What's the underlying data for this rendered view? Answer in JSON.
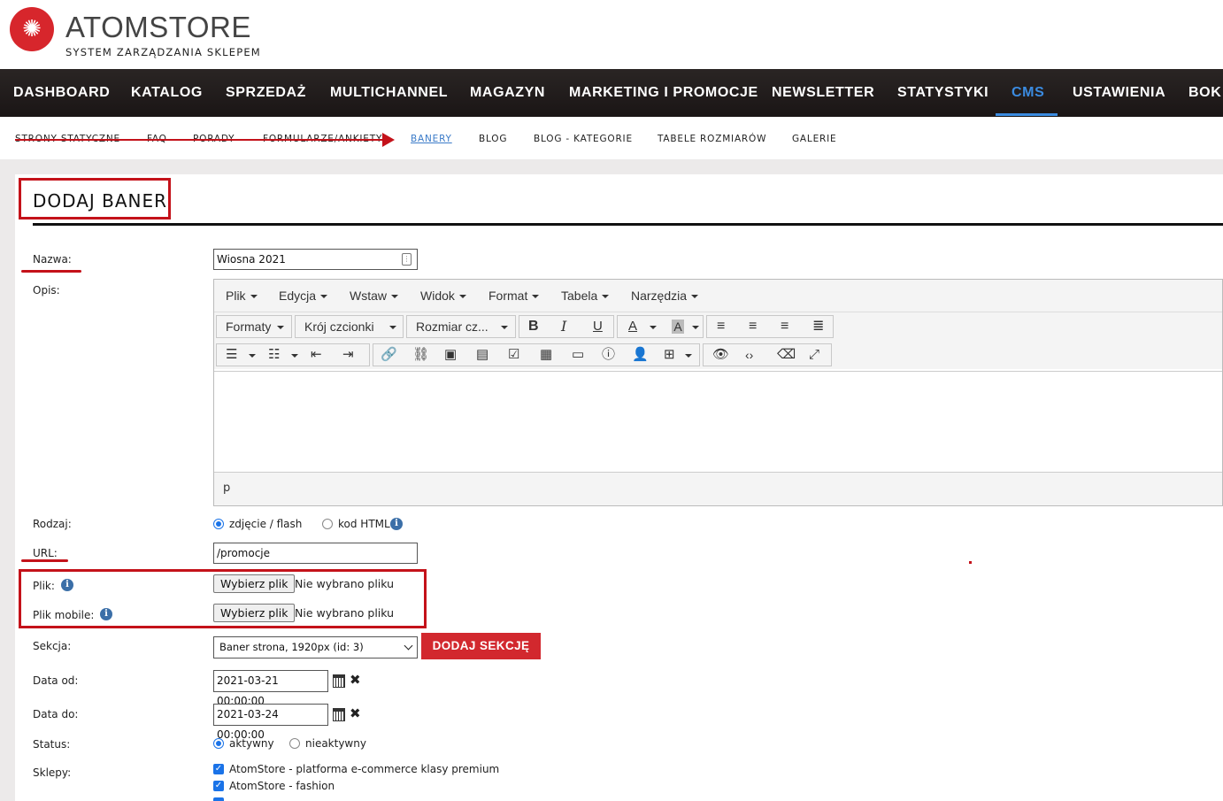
{
  "brand": {
    "name": "ATOMSTORE",
    "subtitle": "SYSTEM ZARZĄDZANIA SKLEPEM"
  },
  "main_nav": [
    "DASHBOARD",
    "KATALOG",
    "SPRZEDAŻ",
    "MULTICHANNEL",
    "MAGAZYN",
    "MARKETING I PROMOCJE",
    "NEWSLETTER",
    "STATYSTYKI",
    "CMS",
    "USTAWIENIA",
    "BOK"
  ],
  "main_nav_active": "CMS",
  "sub_nav": [
    "STRONY STATYCZNE",
    "FAQ",
    "PORADY",
    "FORMULARZE/ANKIETY",
    "BANERY",
    "BLOG",
    "BLOG - KATEGORIE",
    "TABELE ROZMIARÓW",
    "GALERIE"
  ],
  "sub_nav_active": "BANERY",
  "page_title": "DODAJ BANER",
  "form": {
    "name_label": "Nazwa:",
    "name_value": "Wiosna 2021",
    "desc_label": "Opis:",
    "editor": {
      "menus": [
        "Plik",
        "Edycja",
        "Wstaw",
        "Widok",
        "Format",
        "Tabela",
        "Narzędzia"
      ],
      "formats": "Formaty",
      "font": "Krój czcionki",
      "size": "Rozmiar cz...",
      "bold": "B",
      "italic": "I",
      "underline": "U",
      "font_color": "A",
      "bg_color": "A",
      "path": "p"
    },
    "type_label": "Rodzaj:",
    "type_opt1": "zdjęcie / flash",
    "type_opt2": "kod HTML",
    "url_label": "URL:",
    "url_value": "/promocje",
    "file_label": "Plik:",
    "file_mobile_label": "Plik mobile:",
    "file_button": "Wybierz plik",
    "file_none": "Nie wybrano pliku",
    "section_label": "Sekcja:",
    "section_value": "Baner strona, 1920px (id: 3)",
    "add_section_button": "DODAJ SEKCJĘ",
    "date_from_label": "Data od:",
    "date_from_value": "2021-03-21 00:00:00",
    "date_to_label": "Data do:",
    "date_to_value": "2021-03-24 00:00:00",
    "status_label": "Status:",
    "status_active": "aktywny",
    "status_inactive": "nieaktywny",
    "shops_label": "Sklepy:",
    "shops": [
      "AtomStore - platforma e-commerce klasy premium",
      "AtomStore - fashion"
    ]
  },
  "colors": {
    "accent": "#3b8be0",
    "annotation": "#c4121a",
    "button_red": "#d2282e",
    "nav_bg": "#1f1a19"
  }
}
